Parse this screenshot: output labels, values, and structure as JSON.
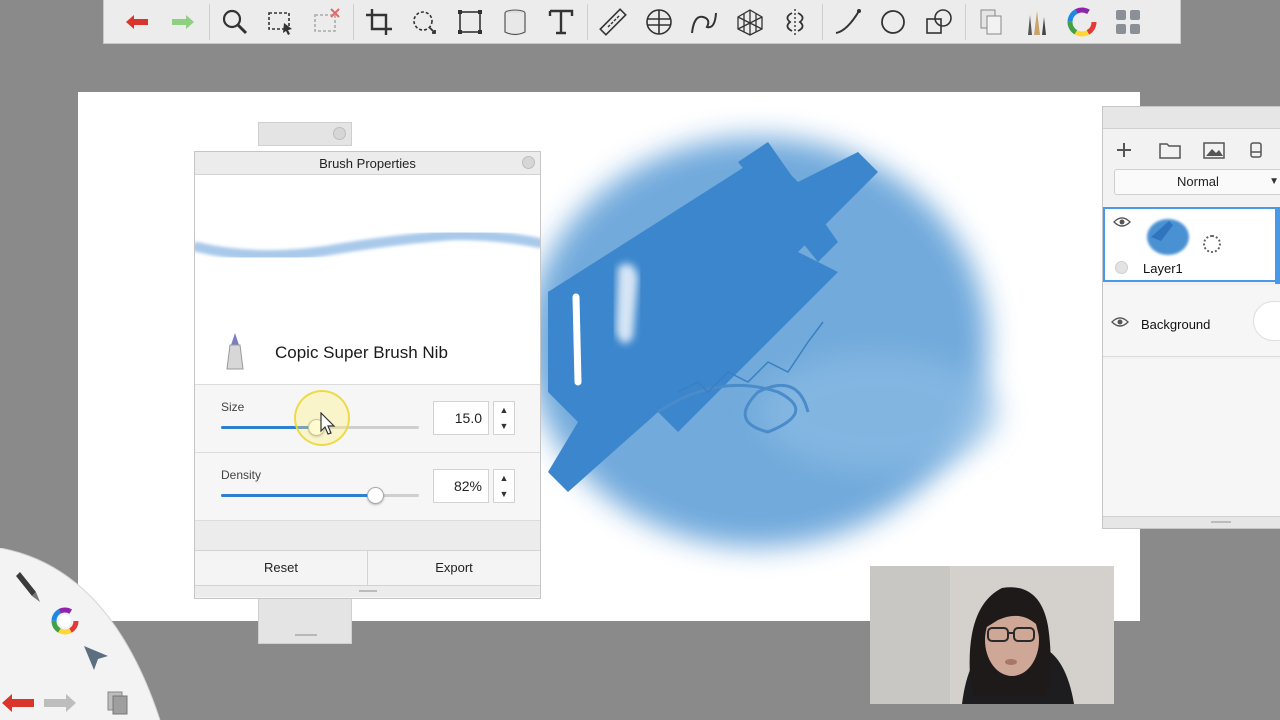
{
  "toolbar": {
    "tools": [
      "undo-icon",
      "redo-icon",
      "zoom-icon",
      "select-icon",
      "select-clear-icon",
      "crop-icon",
      "transform-icon",
      "distort-icon",
      "fill-bucket-icon",
      "text-icon",
      "ruler-icon",
      "ellipse-guide-icon",
      "french-curve-icon",
      "perspective-icon",
      "symmetry-icon",
      "stroke-line-icon",
      "shape-ellipse-icon",
      "stamp-icon",
      "copy-paste-icon",
      "brush-library-icon",
      "color-wheel-icon",
      "ui-toggle-icon"
    ],
    "accent_undo": "#d9352b",
    "accent_redo": "#8fcf82"
  },
  "brush_properties": {
    "title": "Brush Properties",
    "brush_name": "Copic Super Brush Nib",
    "size": {
      "label": "Size",
      "value": "15.0",
      "fraction": 0.48
    },
    "density": {
      "label": "Density",
      "value": "82%",
      "fraction": 0.78
    },
    "reset_label": "Reset",
    "export_label": "Export"
  },
  "layers": {
    "blend_mode": "Normal",
    "items": [
      {
        "name": "Layer1",
        "selected": true
      },
      {
        "name": "Background",
        "selected": false
      }
    ]
  },
  "colors": {
    "stroke_blue": "#3b86cc",
    "accent_blue": "#2f7fd0"
  }
}
